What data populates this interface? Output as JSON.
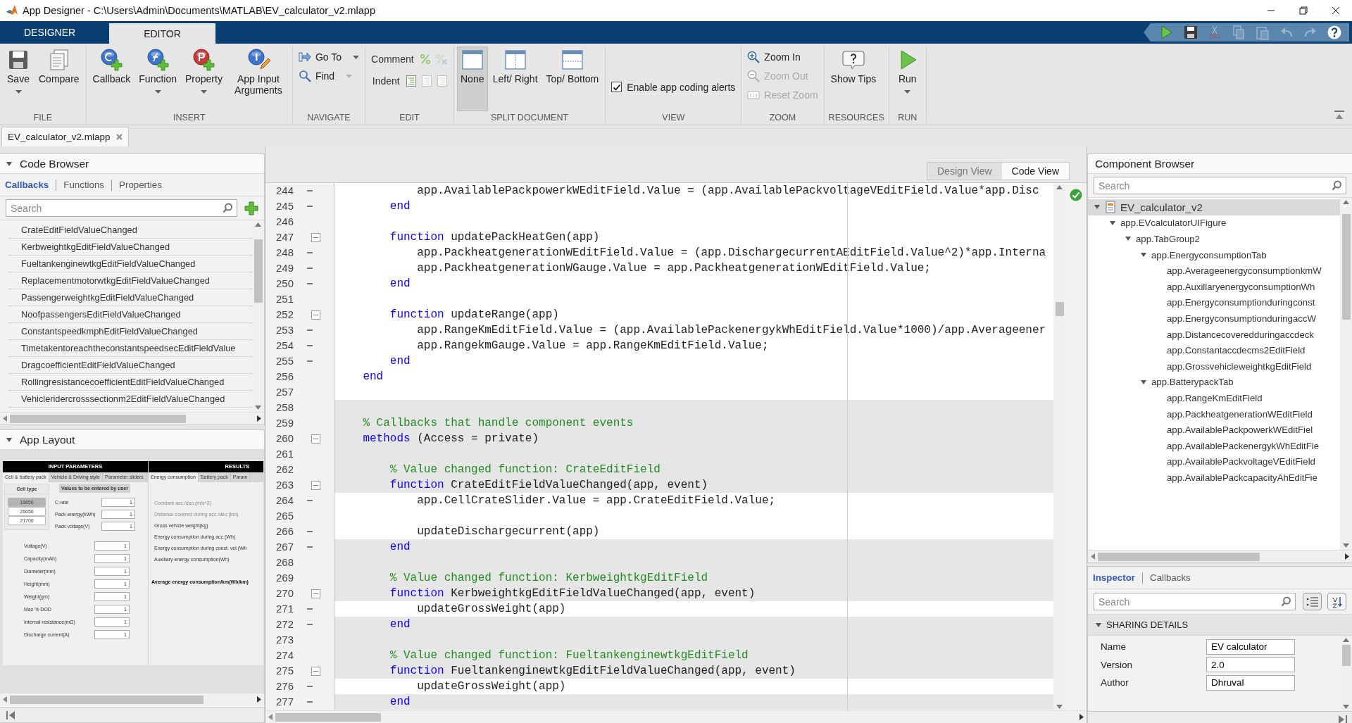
{
  "window": {
    "title": "App Designer - C:\\Users\\Admin\\Documents\\MATLAB\\EV_calculator_v2.mlapp"
  },
  "main_tabs": [
    {
      "label": "DESIGNER",
      "selected": false
    },
    {
      "label": "EDITOR",
      "selected": true
    }
  ],
  "quick_access": [
    {
      "kind": "run",
      "disabled": false
    },
    {
      "kind": "save",
      "disabled": false
    },
    {
      "kind": "cut",
      "disabled": true
    },
    {
      "kind": "copy",
      "disabled": true
    },
    {
      "kind": "paste",
      "disabled": true
    },
    {
      "kind": "undo",
      "disabled": true
    },
    {
      "kind": "redo",
      "disabled": true
    },
    {
      "kind": "help",
      "disabled": false
    }
  ],
  "ribbon": [
    {
      "label": "FILE",
      "items": [
        {
          "kind": "big",
          "label": "Save",
          "caret": true
        },
        {
          "kind": "big",
          "label": "Compare",
          "caret": false
        }
      ]
    },
    {
      "label": "INSERT",
      "items": [
        {
          "kind": "big",
          "label": "Callback",
          "caret": false
        },
        {
          "kind": "big",
          "label": "Function",
          "caret": true
        },
        {
          "kind": "big",
          "label": "Property",
          "caret": true
        },
        {
          "kind": "big",
          "label": "App Input Arguments",
          "caret": false
        }
      ]
    },
    {
      "label": "NAVIGATE",
      "items": [
        {
          "kind": "small",
          "label": "Go To",
          "caret": true,
          "disabled": false
        },
        {
          "kind": "small",
          "label": "Find",
          "caret": true,
          "disabled": false
        }
      ]
    },
    {
      "label": "EDIT",
      "items": [
        {
          "kind": "tools",
          "label": "Comment"
        },
        {
          "kind": "tools",
          "label": "Indent"
        }
      ]
    },
    {
      "label": "SPLIT DOCUMENT",
      "items": [
        {
          "kind": "big",
          "label": "None",
          "caret": false,
          "selected": true
        },
        {
          "kind": "big",
          "label": "Left/ Right",
          "caret": false,
          "selected": false
        },
        {
          "kind": "big",
          "label": "Top/ Bottom",
          "caret": false,
          "selected": false
        }
      ]
    },
    {
      "label": "VIEW",
      "items": [
        {
          "kind": "check",
          "label": "Enable app coding alerts",
          "checked": true
        }
      ]
    },
    {
      "label": "ZOOM",
      "items": [
        {
          "kind": "small",
          "label": "Zoom In",
          "caret": false,
          "disabled": false
        },
        {
          "kind": "small",
          "label": "Zoom Out",
          "caret": false,
          "disabled": true
        },
        {
          "kind": "small",
          "label": "Reset Zoom",
          "caret": false,
          "disabled": true
        }
      ]
    },
    {
      "label": "RESOURCES",
      "items": [
        {
          "kind": "big",
          "label": "Show Tips",
          "caret": false
        }
      ]
    },
    {
      "label": "RUN",
      "items": [
        {
          "kind": "big",
          "label": "Run",
          "caret": true
        }
      ]
    }
  ],
  "document_tabs": [
    {
      "label": "EV_calculator_v2.mlapp",
      "selected": true
    }
  ],
  "code_browser": {
    "title": "Code Browser",
    "expanded": true,
    "tabs": [
      {
        "label": "Callbacks",
        "selected": true
      },
      {
        "label": "Functions",
        "selected": false
      },
      {
        "label": "Properties",
        "selected": false
      }
    ],
    "search": {
      "placeholder": "Search"
    },
    "items": [
      {
        "label": "CrateEditFieldValueChanged",
        "selected": false
      },
      {
        "label": "KerbweightkgEditFieldValueChanged",
        "selected": false
      },
      {
        "label": "FueltankenginewtkgEditFieldValueChanged",
        "selected": false
      },
      {
        "label": "ReplacementmotorwtkgEditFieldValueChanged",
        "selected": false
      },
      {
        "label": "PassengerweightkgEditFieldValueChanged",
        "selected": false
      },
      {
        "label": "NoofpassengersEditFieldValueChanged",
        "selected": false
      },
      {
        "label": "ConstantspeedkmphEditFieldValueChanged",
        "selected": false
      },
      {
        "label": "TimetakentoreachtheconstantspeedsecEditFieldValue",
        "selected": false
      },
      {
        "label": "DragcoefficientEditFieldValueChanged",
        "selected": false
      },
      {
        "label": "RollingresistancecoefficientEditFieldValueChanged",
        "selected": false
      },
      {
        "label": "Vehicleridercrosssectionm2EditFieldValueChanged",
        "selected": false
      }
    ]
  },
  "app_layout": {
    "title": "App Layout",
    "expanded": true,
    "panels": [
      {
        "title": "INPUT PARAMETERS",
        "tabs": [
          {
            "label": "Cell & battery pack",
            "selected": true
          },
          {
            "label": "Vehicle & Driving style",
            "selected": false
          },
          {
            "label": "Parameter sliders",
            "selected": false
          }
        ]
      },
      {
        "title": "RESULTS",
        "tabs": [
          {
            "label": "Energy consumption",
            "selected": true
          },
          {
            "label": "Battery pack",
            "selected": false
          },
          {
            "label": "Param",
            "selected": false
          }
        ]
      }
    ],
    "cell_type": {
      "title": "Cell type",
      "options": [
        {
          "label": "18650",
          "selected": true
        },
        {
          "label": "26650",
          "selected": false
        },
        {
          "label": "21700",
          "selected": false
        }
      ]
    },
    "user_values": {
      "title": "Values to be entered by user",
      "fields": [
        {
          "label": "C-rate",
          "value": "1"
        },
        {
          "label": "Pack energy(kWh)",
          "value": "1"
        },
        {
          "label": "Pack voltage(V)",
          "value": "1"
        }
      ]
    },
    "cell_fields": [
      {
        "label": "Voltage(V)",
        "value": "1"
      },
      {
        "label": "Capacity(mAh)",
        "value": "1"
      },
      {
        "label": "Diameter(mm)",
        "value": "1"
      },
      {
        "label": "Height(mm)",
        "value": "1"
      },
      {
        "label": "Weight(gm)",
        "value": "1"
      },
      {
        "label": "Max % DOD",
        "value": "1"
      },
      {
        "label": "Internal resistance(mΩ)",
        "value": "1"
      },
      {
        "label": "Discharge current(A)",
        "value": "1"
      }
    ],
    "results": [
      {
        "kind": "label",
        "label": "Constant acc./dec.(m/s^2)",
        "disabled": true
      },
      {
        "kind": "label",
        "label": "Distance covered during acc./dec.(km)",
        "disabled": true
      },
      {
        "kind": "label",
        "label": "Gross vehicle weight(kg)",
        "disabled": false
      },
      {
        "kind": "label",
        "label": "Energy consumption during acc.(Wh)",
        "disabled": false
      },
      {
        "kind": "label",
        "label": "Energy consumption during const. vel.(Wh",
        "disabled": false
      },
      {
        "kind": "label",
        "label": "Auxiliary energy consumption(Wh)",
        "disabled": false
      },
      {
        "kind": "total",
        "label": "Average energy consumption/km(Wh/km)",
        "disabled": false
      }
    ]
  },
  "editor": {
    "view_toggle": [
      {
        "label": "Design View",
        "selected": false
      },
      {
        "label": "Code View",
        "selected": true
      }
    ],
    "lines": [
      {
        "number": "244",
        "fold": false,
        "breakpoint": true,
        "editable": true,
        "tokens": [
          {
            "kind": "plain",
            "text": "            app.AvailablePackpowerkWEditField.Value = (app.AvailablePackvoltageVEditField.Value*app.Disc"
          }
        ]
      },
      {
        "number": "245",
        "fold": false,
        "breakpoint": true,
        "editable": true,
        "tokens": [
          {
            "kind": "keyword",
            "text": "        end"
          }
        ]
      },
      {
        "number": "246",
        "fold": false,
        "breakpoint": false,
        "editable": true
      },
      {
        "number": "247",
        "fold": true,
        "breakpoint": false,
        "editable": true,
        "tokens": [
          {
            "kind": "keyword",
            "text": "        function"
          },
          {
            "kind": "plain",
            "text": " updatePackHeatGen(app)"
          }
        ]
      },
      {
        "number": "248",
        "fold": false,
        "breakpoint": true,
        "editable": true,
        "tokens": [
          {
            "kind": "plain",
            "text": "            app.PackheatgenerationWEditField.Value = (app.DischargecurrentAEditField.Value^2)*app.Interna"
          }
        ]
      },
      {
        "number": "249",
        "fold": false,
        "breakpoint": true,
        "editable": true,
        "tokens": [
          {
            "kind": "plain",
            "text": "            app.PackheatgenerationWGauge.Value = app.PackheatgenerationWEditField.Value;"
          }
        ]
      },
      {
        "number": "250",
        "fold": false,
        "breakpoint": true,
        "editable": true,
        "tokens": [
          {
            "kind": "keyword",
            "text": "        end"
          }
        ]
      },
      {
        "number": "251",
        "fold": false,
        "breakpoint": false,
        "editable": true
      },
      {
        "number": "252",
        "fold": true,
        "breakpoint": false,
        "editable": true,
        "tokens": [
          {
            "kind": "keyword",
            "text": "        function"
          },
          {
            "kind": "plain",
            "text": " updateRange(app)"
          }
        ]
      },
      {
        "number": "253",
        "fold": false,
        "breakpoint": true,
        "editable": true,
        "tokens": [
          {
            "kind": "plain",
            "text": "            app.RangeKmEditField.Value = (app.AvailablePackenergykWhEditField.Value*1000)/app.Averageener"
          }
        ]
      },
      {
        "number": "254",
        "fold": false,
        "breakpoint": true,
        "editable": true,
        "tokens": [
          {
            "kind": "plain",
            "text": "            app.RangekmGauge.Value = app.RangeKmEditField.Value;"
          }
        ]
      },
      {
        "number": "255",
        "fold": false,
        "breakpoint": true,
        "editable": true,
        "tokens": [
          {
            "kind": "keyword",
            "text": "        end"
          }
        ]
      },
      {
        "number": "256",
        "fold": false,
        "breakpoint": false,
        "editable": true,
        "tokens": [
          {
            "kind": "keyword",
            "text": "    end"
          }
        ]
      },
      {
        "number": "257",
        "fold": false,
        "breakpoint": false,
        "editable": true
      },
      {
        "number": "258",
        "fold": false,
        "breakpoint": false,
        "editable": false
      },
      {
        "number": "259",
        "fold": false,
        "breakpoint": false,
        "editable": false,
        "tokens": [
          {
            "kind": "comment",
            "text": "    % Callbacks that handle component events"
          }
        ]
      },
      {
        "number": "260",
        "fold": true,
        "breakpoint": false,
        "editable": false,
        "tokens": [
          {
            "kind": "keyword",
            "text": "    methods"
          },
          {
            "kind": "plain",
            "text": " (Access = private)"
          }
        ]
      },
      {
        "number": "261",
        "fold": false,
        "breakpoint": false,
        "editable": false
      },
      {
        "number": "262",
        "fold": false,
        "breakpoint": false,
        "editable": false,
        "tokens": [
          {
            "kind": "comment",
            "text": "        % Value changed function: CrateEditField"
          }
        ]
      },
      {
        "number": "263",
        "fold": true,
        "breakpoint": false,
        "editable": false,
        "tokens": [
          {
            "kind": "keyword",
            "text": "        function"
          },
          {
            "kind": "plain",
            "text": " CrateEditFieldValueChanged(app, event)"
          }
        ]
      },
      {
        "number": "264",
        "fold": false,
        "breakpoint": true,
        "editable": true,
        "tokens": [
          {
            "kind": "plain",
            "text": "            app.CellCrateSlider.Value = app.CrateEditField.Value;"
          }
        ]
      },
      {
        "number": "265",
        "fold": false,
        "breakpoint": false,
        "editable": true
      },
      {
        "number": "266",
        "fold": false,
        "breakpoint": true,
        "editable": true,
        "tokens": [
          {
            "kind": "plain",
            "text": "            updateDischargecurrent(app)"
          }
        ]
      },
      {
        "number": "267",
        "fold": false,
        "breakpoint": true,
        "editable": false,
        "tokens": [
          {
            "kind": "keyword",
            "text": "        end"
          }
        ]
      },
      {
        "number": "268",
        "fold": false,
        "breakpoint": false,
        "editable": false
      },
      {
        "number": "269",
        "fold": false,
        "breakpoint": false,
        "editable": false,
        "tokens": [
          {
            "kind": "comment",
            "text": "        % Value changed function: KerbweightkgEditField"
          }
        ]
      },
      {
        "number": "270",
        "fold": true,
        "breakpoint": false,
        "editable": false,
        "tokens": [
          {
            "kind": "keyword",
            "text": "        function"
          },
          {
            "kind": "plain",
            "text": " KerbweightkgEditFieldValueChanged(app, event)"
          }
        ]
      },
      {
        "number": "271",
        "fold": false,
        "breakpoint": true,
        "editable": true,
        "tokens": [
          {
            "kind": "plain",
            "text": "            updateGrossWeight(app)"
          }
        ]
      },
      {
        "number": "272",
        "fold": false,
        "breakpoint": true,
        "editable": false,
        "tokens": [
          {
            "kind": "keyword",
            "text": "        end"
          }
        ]
      },
      {
        "number": "273",
        "fold": false,
        "breakpoint": false,
        "editable": false
      },
      {
        "number": "274",
        "fold": false,
        "breakpoint": false,
        "editable": false,
        "tokens": [
          {
            "kind": "comment",
            "text": "        % Value changed function: FueltankenginewtkgEditField"
          }
        ]
      },
      {
        "number": "275",
        "fold": true,
        "breakpoint": false,
        "editable": false,
        "tokens": [
          {
            "kind": "keyword",
            "text": "        function"
          },
          {
            "kind": "plain",
            "text": " FueltankenginewtkgEditFieldValueChanged(app, event)"
          }
        ]
      },
      {
        "number": "276",
        "fold": false,
        "breakpoint": true,
        "editable": true,
        "tokens": [
          {
            "kind": "plain",
            "text": "            updateGrossWeight(app)"
          }
        ]
      },
      {
        "number": "277",
        "fold": false,
        "breakpoint": true,
        "editable": false,
        "tokens": [
          {
            "kind": "keyword",
            "text": "        end"
          }
        ]
      }
    ]
  },
  "component_browser": {
    "title": "Component Browser",
    "search": {
      "placeholder": "Search"
    },
    "tree": [
      {
        "label": "EV_calculator_v2",
        "selected": true,
        "expanded": true,
        "children": [
          {
            "label": "app.EVcalculatorUIFigure",
            "selected": false,
            "expanded": true,
            "children": [
              {
                "label": "app.TabGroup2",
                "selected": false,
                "expanded": true,
                "children": [
                  {
                    "label": "app.EnergyconsumptionTab",
                    "selected": false,
                    "expanded": true,
                    "children": [
                      {
                        "label": "app.AverageenergyconsumptionkmW",
                        "selected": false
                      },
                      {
                        "label": "app.AuxillaryenergyconsumptionWh",
                        "selected": false
                      },
                      {
                        "label": "app.Energyconsumptionduringconst",
                        "selected": false
                      },
                      {
                        "label": "app.EnergyconsumptionduringaccW",
                        "selected": false
                      },
                      {
                        "label": "app.Distancecoveredduringaccdeck",
                        "selected": false
                      },
                      {
                        "label": "app.Constantaccdecms2EditField",
                        "selected": false
                      },
                      {
                        "label": "app.GrossvehicleweightkgEditField",
                        "selected": false
                      }
                    ]
                  },
                  {
                    "label": "app.BatterypackTab",
                    "selected": false,
                    "expanded": true,
                    "children": [
                      {
                        "label": "app.RangeKmEditField",
                        "selected": false
                      },
                      {
                        "label": "app.PackheatgenerationWEditField",
                        "selected": false
                      },
                      {
                        "label": "app.AvailablePackpowerkWEditFiel",
                        "selected": false
                      },
                      {
                        "label": "app.AvailablePackenergykWhEditFie",
                        "selected": false
                      },
                      {
                        "label": "app.AvailablePackvoltageVEditField",
                        "selected": false
                      },
                      {
                        "label": "app.AvailablePackcapacityAhEditFie",
                        "selected": false
                      }
                    ]
                  }
                ]
              }
            ]
          }
        ]
      }
    ]
  },
  "inspector": {
    "tabs": [
      {
        "label": "Inspector",
        "selected": true
      },
      {
        "label": "Callbacks",
        "selected": false
      }
    ],
    "search": {
      "placeholder": "Search"
    },
    "section": {
      "title": "SHARING DETAILS",
      "expanded": true
    },
    "properties": [
      {
        "label": "Name",
        "value": "EV calculator"
      },
      {
        "label": "Version",
        "value": "2.0"
      },
      {
        "label": "Author",
        "value": "Dhruval"
      }
    ]
  }
}
